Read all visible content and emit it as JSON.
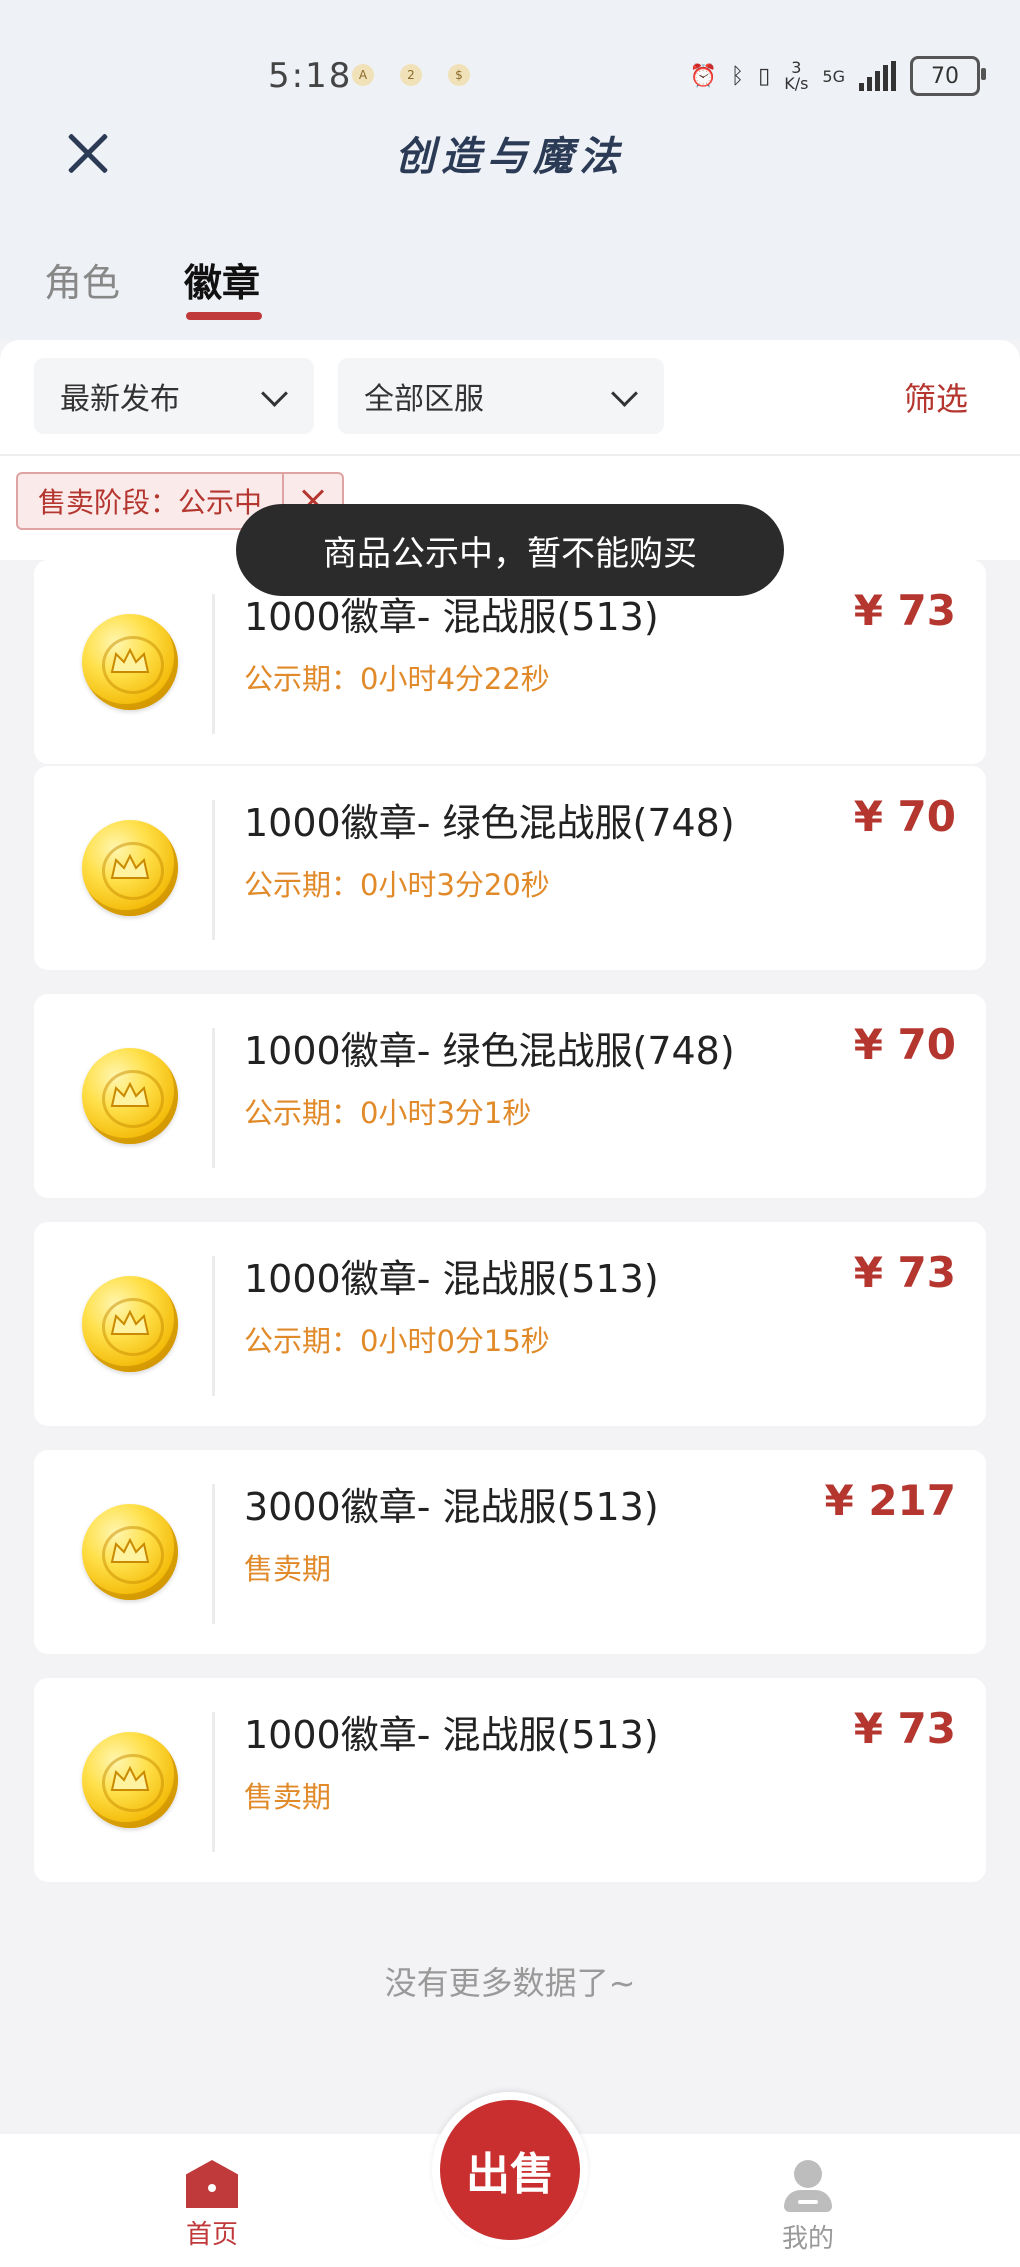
{
  "status": {
    "time": "5:18",
    "net_speed": "3\nK/s",
    "network": "5G",
    "battery": "70"
  },
  "header": {
    "title": "创造与魔法"
  },
  "tabs": [
    {
      "label": "角色",
      "active": false
    },
    {
      "label": "徽章",
      "active": true
    }
  ],
  "filters": {
    "sort": "最新发布",
    "region": "全部区服",
    "filter_label": "筛选",
    "tag": "售卖阶段：公示中"
  },
  "toast": "商品公示中，暂不能购买",
  "items": [
    {
      "title": "1000徽章- 混战服(513)",
      "sub": "公示期：0小时4分22秒",
      "price": "¥ 73"
    },
    {
      "title": "1000徽章- 绿色混战服(748)",
      "sub": "公示期：0小时3分20秒",
      "price": "¥ 70"
    },
    {
      "title": "1000徽章- 绿色混战服(748)",
      "sub": "公示期：0小时3分1秒",
      "price": "¥ 70"
    },
    {
      "title": "1000徽章- 混战服(513)",
      "sub": "公示期：0小时0分15秒",
      "price": "¥ 73"
    },
    {
      "title": "3000徽章- 混战服(513)",
      "sub": "售卖期",
      "price": "¥ 217"
    },
    {
      "title": "1000徽章- 混战服(513)",
      "sub": "售卖期",
      "price": "¥ 73"
    }
  ],
  "no_more": "没有更多数据了~",
  "bottom_nav": {
    "home": "首页",
    "sell": "出售",
    "mine": "我的"
  },
  "colors": {
    "accent": "#c0393b",
    "price": "#b4362f",
    "period": "#e18a2a"
  }
}
